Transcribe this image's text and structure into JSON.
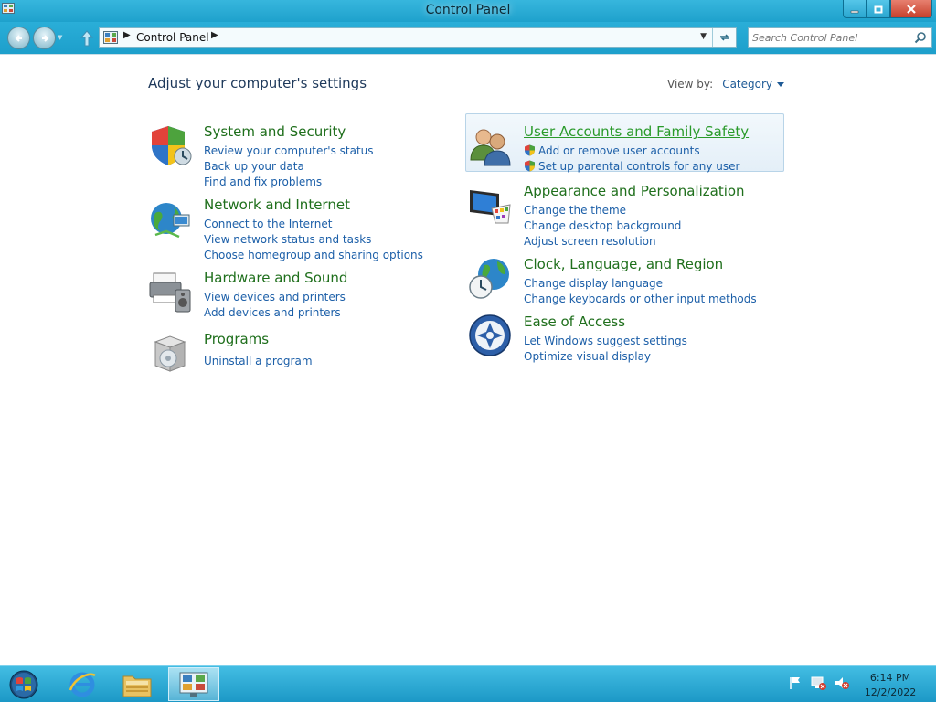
{
  "window": {
    "title": "Control Panel"
  },
  "address": {
    "crumb": "Control Panel"
  },
  "search": {
    "placeholder": "Search Control Panel"
  },
  "main": {
    "heading": "Adjust your computer's settings",
    "view_by_label": "View by:",
    "view_by_value": "Category"
  },
  "categories": [
    {
      "title": "System and Security",
      "icon": "shield-icon",
      "links": [
        "Review your computer's status",
        "Back up your data",
        "Find and fix problems"
      ]
    },
    {
      "title": "Network and Internet",
      "icon": "network-globe-icon",
      "links": [
        "Connect to the Internet",
        "View network status and tasks",
        "Choose homegroup and sharing options"
      ]
    },
    {
      "title": "Hardware and Sound",
      "icon": "printer-speaker-icon",
      "links": [
        "View devices and printers",
        "Add devices and printers"
      ]
    },
    {
      "title": "Programs",
      "icon": "programs-box-icon",
      "links": [
        "Uninstall a program"
      ]
    },
    {
      "title": "User Accounts and Family Safety",
      "icon": "users-icon",
      "links": [
        "Add or remove user accounts",
        "Set up parental controls for any user"
      ]
    },
    {
      "title": "Appearance and Personalization",
      "icon": "monitor-palette-icon",
      "links": [
        "Change the theme",
        "Change desktop background",
        "Adjust screen resolution"
      ]
    },
    {
      "title": "Clock, Language, and Region",
      "icon": "globe-clock-icon",
      "links": [
        "Change display language",
        "Change keyboards or other input methods"
      ]
    },
    {
      "title": "Ease of Access",
      "icon": "ease-of-access-icon",
      "links": [
        "Let Windows suggest settings",
        "Optimize visual display"
      ]
    }
  ],
  "taskbar": {
    "items": [
      "start-orb-icon",
      "internet-explorer-icon",
      "file-explorer-icon",
      "control-panel-icon"
    ],
    "time": "6:14 PM",
    "date": "12/2/2022"
  },
  "colors": {
    "titlebar": "#1ea1cc",
    "category_title": "#1f6f1c",
    "link": "#1c5fa8",
    "heading": "#1e395b"
  }
}
